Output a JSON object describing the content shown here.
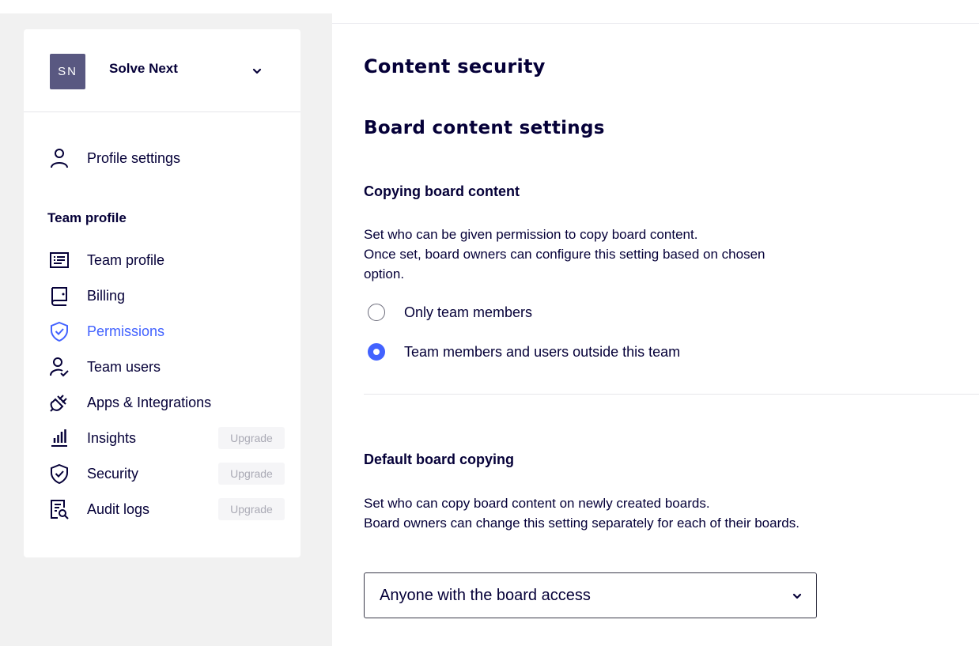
{
  "team": {
    "initials": "SN",
    "name": "Solve Next"
  },
  "sidebar": {
    "profile_item": {
      "label": "Profile settings",
      "icon": "user-icon"
    },
    "section_label": "Team profile",
    "items": [
      {
        "label": "Team profile",
        "icon": "id-card-icon",
        "active": false
      },
      {
        "label": "Billing",
        "icon": "billing-icon",
        "active": false
      },
      {
        "label": "Permissions",
        "icon": "shield-icon",
        "active": true
      },
      {
        "label": "Team users",
        "icon": "user-check-icon",
        "active": false
      },
      {
        "label": "Apps & Integrations",
        "icon": "plug-icon",
        "active": false
      },
      {
        "label": "Insights",
        "icon": "bar-chart-icon",
        "active": false,
        "badge": "Upgrade"
      },
      {
        "label": "Security",
        "icon": "shield-check-icon",
        "active": false,
        "badge": "Upgrade"
      },
      {
        "label": "Audit logs",
        "icon": "audit-log-icon",
        "active": false,
        "badge": "Upgrade"
      }
    ]
  },
  "main": {
    "title": "Content security",
    "subtitle": "Board content settings",
    "copying": {
      "title": "Copying board content",
      "desc_line1": "Set who can be given permission to copy board content.",
      "desc_line2": "Once set, board owners can configure this setting based on chosen option.",
      "options": [
        {
          "label": "Only team members",
          "checked": false
        },
        {
          "label": "Team members and users outside this team",
          "checked": true
        }
      ]
    },
    "default_copying": {
      "title": "Default board copying",
      "desc_line1": "Set who can copy board content on newly created boards.",
      "desc_line2": "Board owners can change this setting separately for each of their boards.",
      "select_value": "Anyone with the board access"
    }
  },
  "colors": {
    "accent": "#4262ff",
    "text": "#050038",
    "avatar_bg": "#595881",
    "sidebar_bg": "#f1f1f1"
  }
}
